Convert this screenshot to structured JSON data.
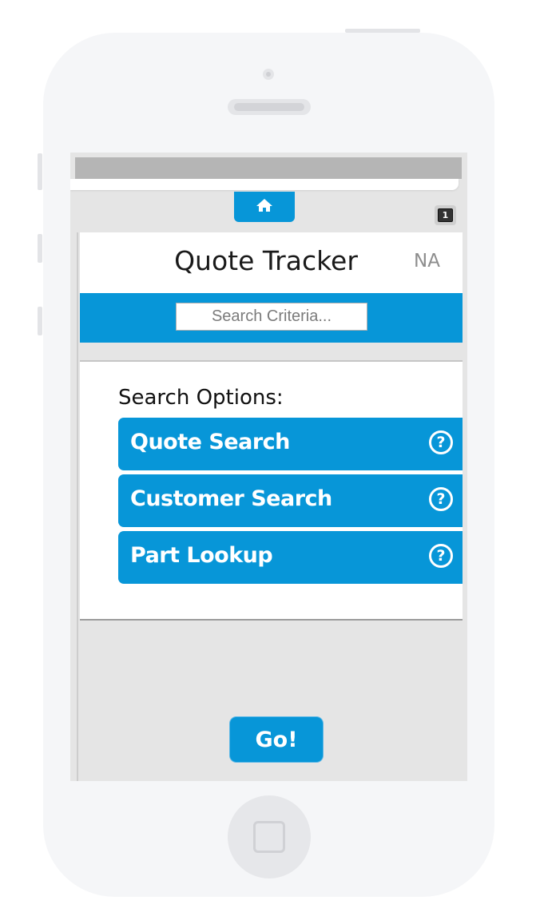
{
  "app": {
    "title": "Quote Tracker",
    "region": "NA",
    "notification_count": "1"
  },
  "search": {
    "placeholder": "Search Criteria..."
  },
  "options": {
    "heading": "Search Options:",
    "items": [
      {
        "label": "Quote Search",
        "icon": "question-circle-icon"
      },
      {
        "label": "Customer Search",
        "icon": "question-circle-icon"
      },
      {
        "label": "Part Lookup",
        "icon": "question-circle-icon"
      }
    ],
    "help_glyph": "?"
  },
  "actions": {
    "go_label": "Go!"
  },
  "colors": {
    "accent": "#0796d8",
    "background": "#e5e5e5",
    "device_shell": "#f5f6f8"
  }
}
